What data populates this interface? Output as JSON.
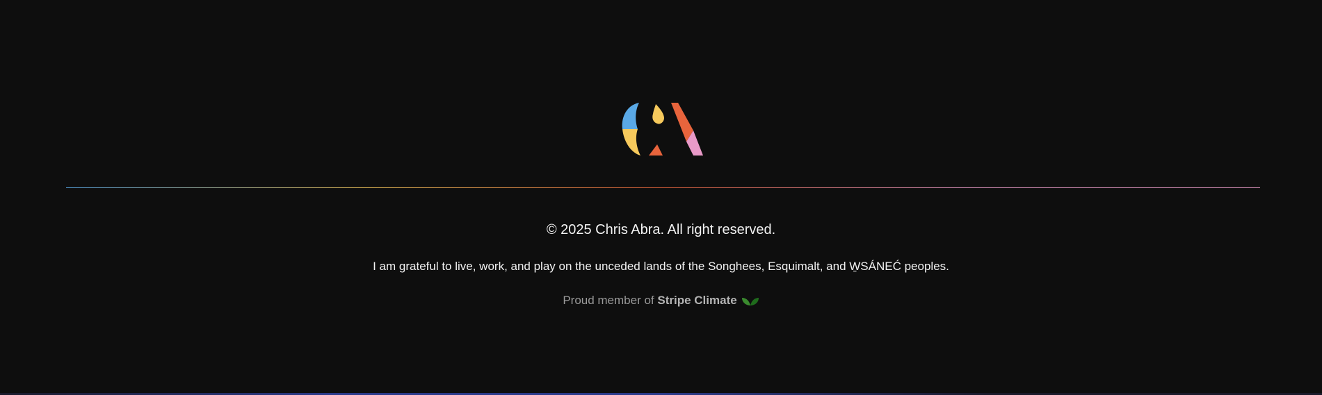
{
  "footer": {
    "logo_icon": "chris-abra-monogram-icon",
    "logo_colors": {
      "blue": "#5aa9e6",
      "yellow": "#f6c95c",
      "orange": "#e8643c",
      "pink": "#e99ac8"
    },
    "divider_colors": [
      "#5aa9e6",
      "#f6c95c",
      "#e8643c",
      "#e99ac8"
    ],
    "copyright": "© 2025 Chris Abra. All right reserved.",
    "land_acknowledgement": "I am grateful to live, work, and play on the unceded lands of the Songhees, Esquimalt, and W̱SÁNEĆ peoples.",
    "member_prefix": "Proud member of ",
    "member_brand": "Stripe Climate",
    "member_icon": "leaf-icon",
    "leaf_colors": [
      "#3a8a2e",
      "#1f6b1c"
    ]
  },
  "bottom_bar_colors": [
    "#1a1a2a",
    "#2b3a8a",
    "#2b3a8a",
    "#1a1a2a"
  ]
}
